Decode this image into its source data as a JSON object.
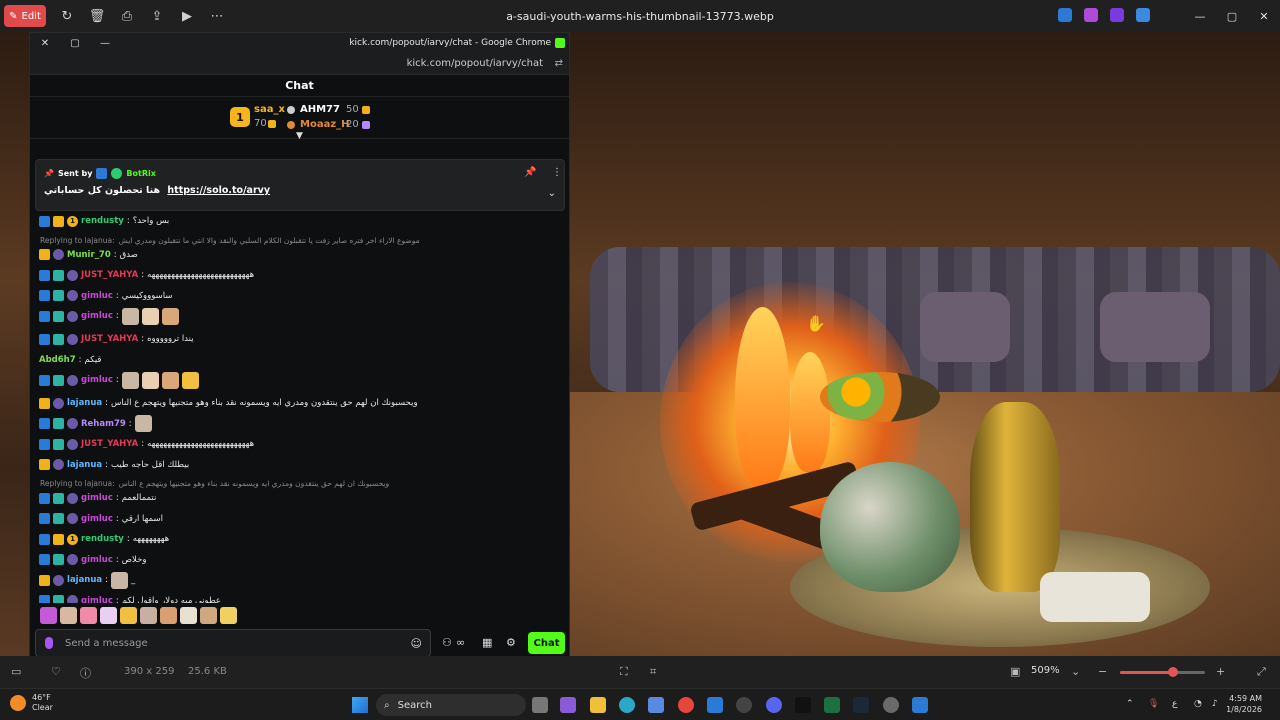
{
  "photos_app": {
    "edit_label": "Edit",
    "file_title": "a-saudi-youth-warms-his-thumbnail-13773.webp",
    "dimensions": "390 x 259",
    "file_size": "25.6 KB",
    "zoom": "509%",
    "zoom_level": 0.62
  },
  "chrome": {
    "title": "kick.com/popout/iarvy/chat - Google Chrome",
    "url": "kick.com/popout/iarvy/chat"
  },
  "chat": {
    "header": "Chat",
    "leaderboard": {
      "first": {
        "rank": "1",
        "name": "saa_x",
        "score": "70"
      },
      "second": {
        "name": "AHM77",
        "score": "50"
      },
      "third": {
        "name": "Moaaz_H",
        "score": "20"
      }
    },
    "pinned": {
      "sent_by": "Sent by",
      "sender": "BotRix",
      "message": "هنا تحصلون كل حساباتي",
      "link": "https://solo.to/arvy"
    },
    "messages": [
      {
        "user": "rendusty",
        "color": "#2ecc71",
        "text": "بس واحد؟",
        "badges": [
          "blue",
          "crown",
          "one"
        ]
      },
      {
        "reply": "Replying to lajanua:",
        "reply_text": "موضوع الاراء اخر فتره صاير زفت يا تتقبلون الكلام السلبي والنقد والا انتي ما تتقبلون ومدري ايش"
      },
      {
        "user": "Munir_70",
        "color": "#7ee04a",
        "text": "صدق",
        "badges": [
          "crown",
          "moon"
        ]
      },
      {
        "user": "JUST_YAHYA",
        "color": "#e63a5a",
        "text": "ههههههههههههههههههههههههههه",
        "badges": [
          "blue",
          "teal",
          "moon"
        ]
      },
      {
        "user": "gimluc",
        "color": "#c84ad8",
        "text": "ساسوووكيسي",
        "badges": [
          "blue",
          "teal",
          "moon"
        ]
      },
      {
        "user": "gimluc",
        "color": "#c84ad8",
        "text": "",
        "emotes": 3,
        "badges": [
          "blue",
          "teal",
          "moon"
        ]
      },
      {
        "user": "JUST_YAHYA",
        "color": "#e63a5a",
        "text": "يندا تروووووه",
        "badges": [
          "blue",
          "teal",
          "moon"
        ]
      },
      {
        "user": "Abd6h7",
        "color": "#7ee04a",
        "text": "قيكم",
        "badges": []
      },
      {
        "user": "gimluc",
        "color": "#c84ad8",
        "text": "",
        "emotes": 4,
        "badges": [
          "blue",
          "teal",
          "moon"
        ]
      },
      {
        "user": "lajanua",
        "color": "#5ab8ff",
        "text": "ويحسبونك ان لهم حق ينتقدون ومدري ايه ويسمونه نقد بناء وهو متجنيها ويتهجم ع الناس",
        "badges": [
          "crown",
          "moon"
        ]
      },
      {
        "user": "Reham79",
        "color": "#b58aff",
        "text": "",
        "emotes": 1,
        "badges": [
          "blue",
          "teal",
          "moon"
        ]
      },
      {
        "user": "JUST_YAHYA",
        "color": "#e63a5a",
        "text": "ههههههههههههههههههههههههههه",
        "badges": [
          "blue",
          "teal",
          "moon"
        ]
      },
      {
        "user": "lajanua",
        "color": "#5ab8ff",
        "text": "بيطلك اقل حاجه طيب",
        "badges": [
          "crown",
          "moon"
        ]
      },
      {
        "reply": "Replying to lajanua:",
        "reply_text": "ويحسبونك ان لهم حق ينتقدون ومدري ايه ويسمونه نقد بناء وهو متجنيها ويتهجم ع الناس"
      },
      {
        "user": "gimluc",
        "color": "#c84ad8",
        "text": "نتممالعمم",
        "badges": [
          "blue",
          "teal",
          "moon"
        ]
      },
      {
        "user": "gimluc",
        "color": "#c84ad8",
        "text": "اسمها ارقي",
        "badges": [
          "blue",
          "teal",
          "moon"
        ]
      },
      {
        "user": "rendusty",
        "color": "#2ecc71",
        "text": "ههههههههه",
        "badges": [
          "blue",
          "crown",
          "one"
        ]
      },
      {
        "user": "gimluc",
        "color": "#c84ad8",
        "text": "وخلاص",
        "badges": [
          "blue",
          "teal",
          "moon"
        ]
      },
      {
        "user": "lajanua",
        "color": "#5ab8ff",
        "text": "_",
        "emotes": 1,
        "badges": [
          "crown",
          "moon"
        ]
      },
      {
        "user": "gimluc",
        "color": "#c84ad8",
        "text": "عطوني ميه دولار واقول لكم",
        "badges": [
          "blue",
          "teal",
          "moon"
        ]
      }
    ],
    "placeholder": "Send a message",
    "chat_button": "Chat"
  },
  "taskbar": {
    "temperature": "46°F",
    "weather": "Clear",
    "search": "Search",
    "time": "4:59 AM",
    "date": "1/8/2026"
  }
}
